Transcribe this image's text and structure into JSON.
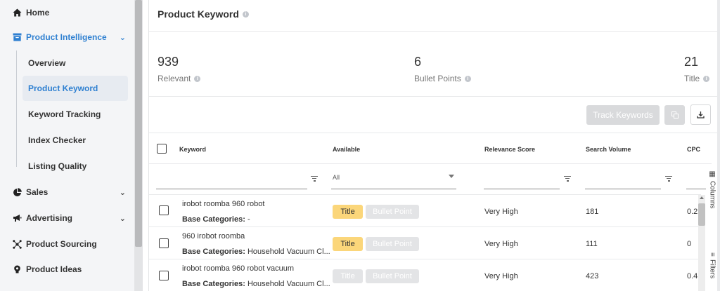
{
  "sidebar": {
    "items": [
      {
        "label": "Home",
        "icon": "home-icon"
      },
      {
        "label": "Product Intelligence",
        "icon": "archive-box-icon"
      },
      {
        "label": "Sales",
        "icon": "pie-chart-icon"
      },
      {
        "label": "Advertising",
        "icon": "megaphone-icon"
      },
      {
        "label": "Product Sourcing",
        "icon": "network-icon"
      },
      {
        "label": "Product Ideas",
        "icon": "lightbulb-icon"
      }
    ],
    "sub_items": [
      "Overview",
      "Product Keyword",
      "Keyword Tracking",
      "Index Checker",
      "Listing Quality"
    ],
    "active_sub": "Product Keyword"
  },
  "header": {
    "title": "Product Keyword"
  },
  "stats": [
    {
      "value": "939",
      "label": "Relevant"
    },
    {
      "value": "6",
      "label": "Bullet Points"
    },
    {
      "value": "21",
      "label": "Title"
    }
  ],
  "toolbar": {
    "track_label": "Track Keywords"
  },
  "table": {
    "columns": [
      "Keyword",
      "Available",
      "Relevance Score",
      "Search Volume",
      "CPC"
    ],
    "available_filter": "All",
    "base_categories_label": "Base Categories:",
    "tag_title": "Title",
    "tag_bullet": "Bullet Point",
    "rows": [
      {
        "keyword": "irobot roomba 960 robot",
        "base_categories": "-",
        "title_on": true,
        "bullet_on": false,
        "relevance": "Very High",
        "volume": "181",
        "cpc": "0.2"
      },
      {
        "keyword": "960 irobot roomba",
        "base_categories": "Household Vacuum Cl...",
        "title_on": true,
        "bullet_on": false,
        "relevance": "Very High",
        "volume": "111",
        "cpc": "0"
      },
      {
        "keyword": "irobot roomba 960 robot vacuum",
        "base_categories": "Household Vacuum Cl...",
        "title_on": false,
        "bullet_on": false,
        "relevance": "Very High",
        "volume": "423",
        "cpc": "0.4"
      }
    ]
  },
  "side_tabs": {
    "columns": "Columns",
    "filters": "Filters"
  },
  "colors": {
    "accent": "#2f80d1",
    "tag_active": "#fbd67a",
    "tag_inactive": "#e3e4e6",
    "sidebar_bg": "#f4f5f7"
  }
}
